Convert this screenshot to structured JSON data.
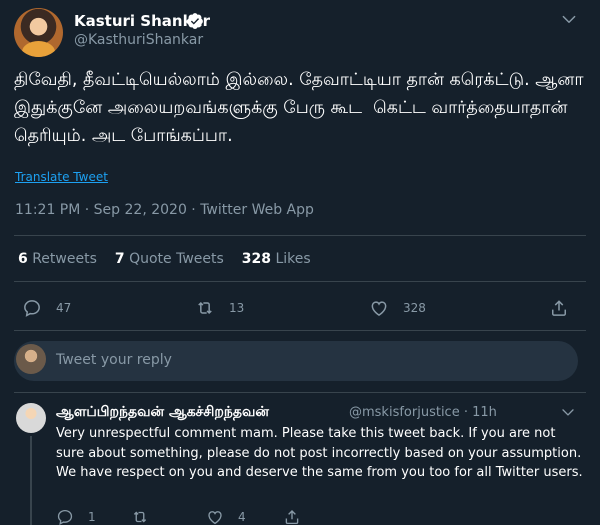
{
  "tweet": {
    "display_name": "Kasturi Shankar",
    "handle": "@KasthuriShankar",
    "text": "திவேதி, தீவட்டியெல்லாம் இல்லை. தேவாட்டியா தான் கரெக்ட்டு. ஆனா இதுக்குனே அலையறவங்களுக்கு பேரு கூட  கெட்ட வார்த்தையாதான் தெரியும். அட போங்கப்பா.",
    "translate_label": "Translate Tweet",
    "meta": "11:21 PM · Sep 22, 2020 · Twitter Web App"
  },
  "stats": {
    "retweets_count": "6",
    "retweets_label": "Retweets",
    "quotes_count": "7",
    "quotes_label": "Quote Tweets",
    "likes_count": "328",
    "likes_label": "Likes"
  },
  "actions": {
    "reply_count": "47",
    "retweet_count": "13",
    "like_count": "328"
  },
  "reply_input": {
    "placeholder": "Tweet your reply"
  },
  "reply": {
    "display_name": "ஆளப்பிறந்தவன் ஆகச்சிறந்தவன்",
    "handle_time": "@mskisforjustice · 11h",
    "text": "Very unrespectful comment mam. Please take this tweet back. If you are not sure about something, please do not post incorrectly based on your assumption. We have respect on you and deserve the same from you too for all Twitter users.",
    "reply_count": "1",
    "like_count": "4"
  },
  "colors": {
    "background": "#15202b",
    "secondary_text": "#8899a6",
    "accent": "#1da1f2",
    "divider": "#38444d"
  }
}
